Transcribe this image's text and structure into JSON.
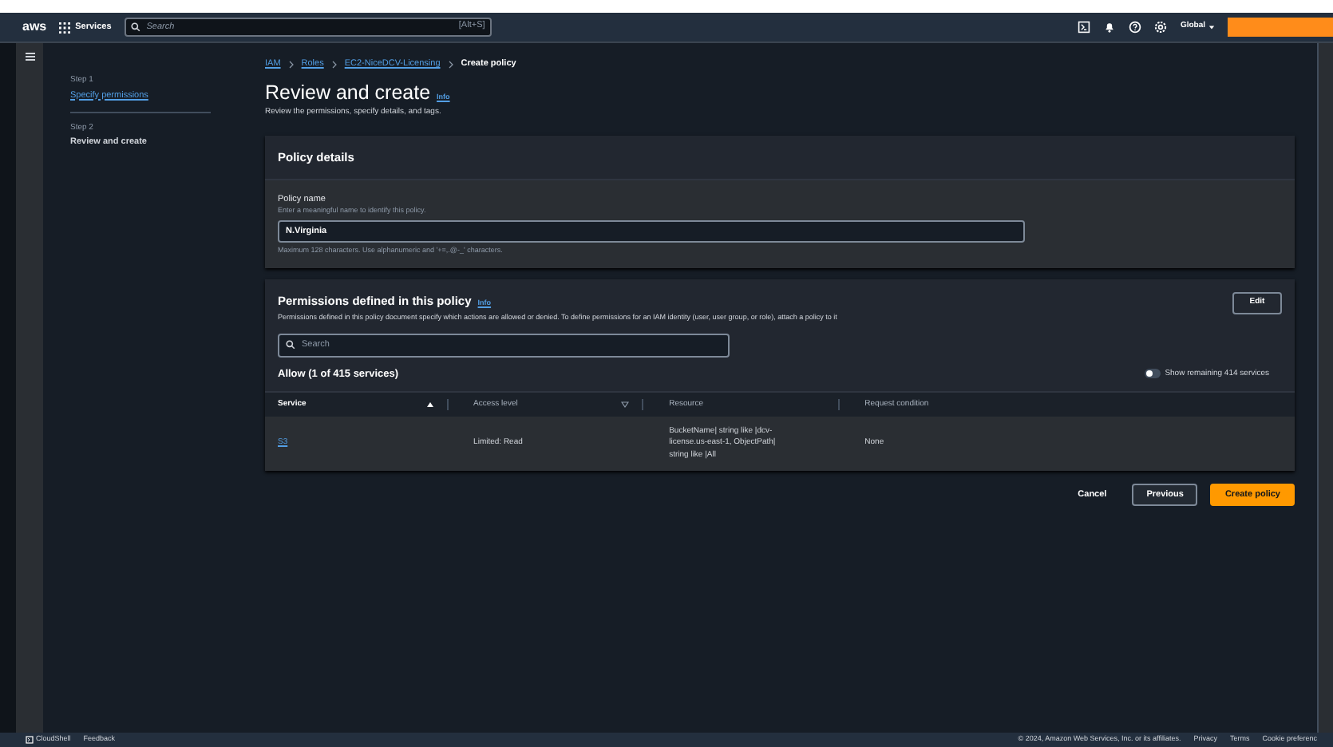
{
  "top_nav": {
    "logo": "aws",
    "services": "Services",
    "search_placeholder": "Search",
    "shortcut": "[Alt+S]",
    "region": "Global"
  },
  "breadcrumb": [
    {
      "label": "IAM",
      "link": true
    },
    {
      "label": "Roles",
      "link": true
    },
    {
      "label": "EC2-NiceDCV-Licensing",
      "link": true
    },
    {
      "label": "Create policy",
      "link": false
    }
  ],
  "steps": [
    {
      "step": "Step 1",
      "title": "Specify permissions",
      "selected": false
    },
    {
      "step": "Step 2",
      "title": "Review and create",
      "selected": true
    }
  ],
  "page": {
    "title": "Review and create",
    "info": "Info",
    "subtitle": "Review the permissions, specify details, and tags."
  },
  "policy_details": {
    "title": "Policy details",
    "field_label": "Policy name",
    "field_hint": "Enter a meaningful name to identify this policy.",
    "value": "N.Virginia",
    "constraint": "Maximum 128 characters. Use alphanumeric and '+=,.@-_' characters."
  },
  "permissions": {
    "title": "Permissions defined in this policy",
    "info": "Info",
    "description": "Permissions defined in this policy document specify which actions are allowed or denied. To define permissions for an IAM identity (user, user group, or role), attach a policy to it",
    "edit": "Edit",
    "search_placeholder": "Search",
    "count": "Allow (1 of 415 services)",
    "toggle": {
      "label": "Show remaining 414 services",
      "on": false
    },
    "table": {
      "columns": [
        {
          "label": "Service",
          "sorted": true
        },
        {
          "label": "Access level",
          "sorted": false
        },
        {
          "label": "Resource"
        },
        {
          "label": "Request condition"
        }
      ],
      "rows": [
        [
          "S3",
          "Limited: Read",
          "BucketName| string like |dcv-license.us-east-1, ObjectPath| string like |All",
          "None"
        ]
      ]
    }
  },
  "actions": [
    {
      "label": "Cancel",
      "kind": "link"
    },
    {
      "label": "Previous",
      "kind": "secondary"
    },
    {
      "label": "Create policy",
      "kind": "primary"
    }
  ],
  "footer": {
    "tools": [
      "CloudShell",
      "Feedback"
    ],
    "copyright": "© 2024, Amazon Web Services, Inc. or its affiliates.",
    "links": [
      "Privacy",
      "Terms",
      "Cookie preferenc"
    ]
  }
}
